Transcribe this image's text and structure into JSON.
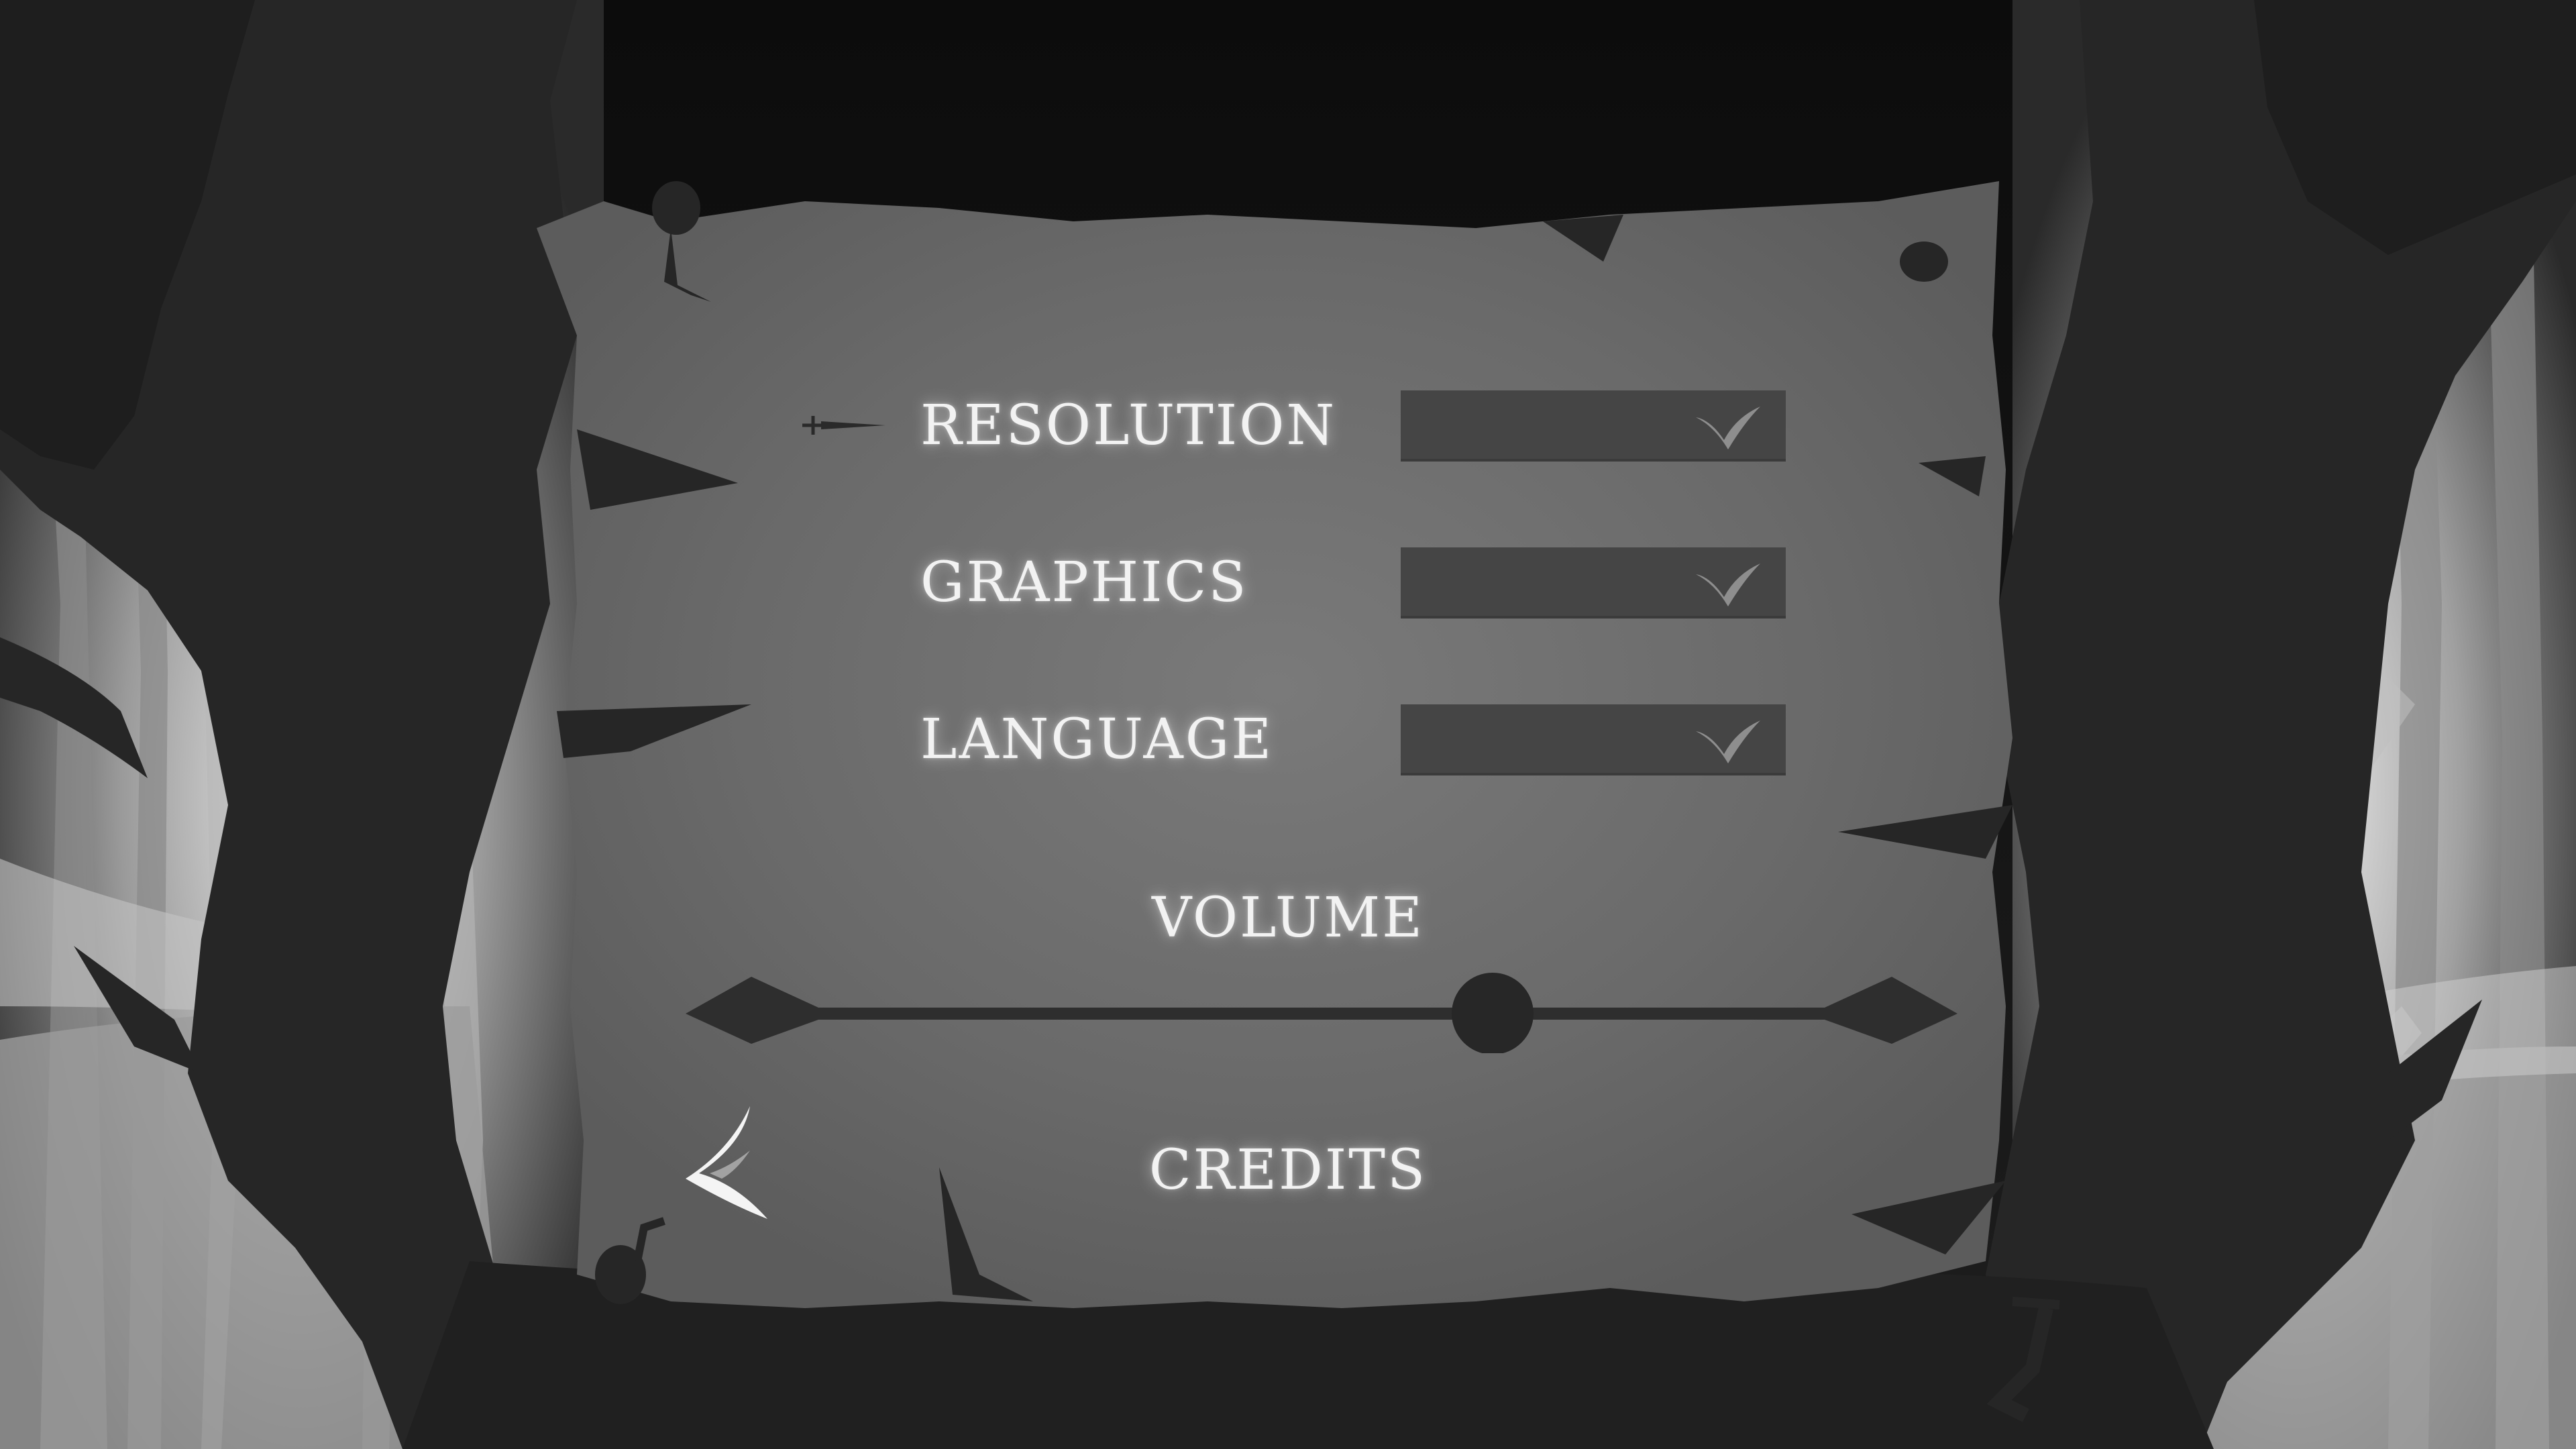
{
  "menu": {
    "resolution_label": "RESOLUTION",
    "graphics_label": "GRAPHICS",
    "language_label": "LANGUAGE",
    "volume_label": "VOLUME",
    "credits_label": "CREDITS"
  },
  "dropdowns": {
    "resolution_value": "",
    "graphics_value": "",
    "language_value": ""
  },
  "volume": {
    "level": 0.67
  },
  "icons": {
    "selector": "dagger-icon",
    "dropdown": "bird-chevron-icon",
    "back": "back-arrow-icon"
  },
  "colors": {
    "parchment": "#6a6a6a",
    "trees": "#262626",
    "text": "#f2f2f2",
    "dropdown_bg": "#454545",
    "slider": "#2e2e2e"
  }
}
